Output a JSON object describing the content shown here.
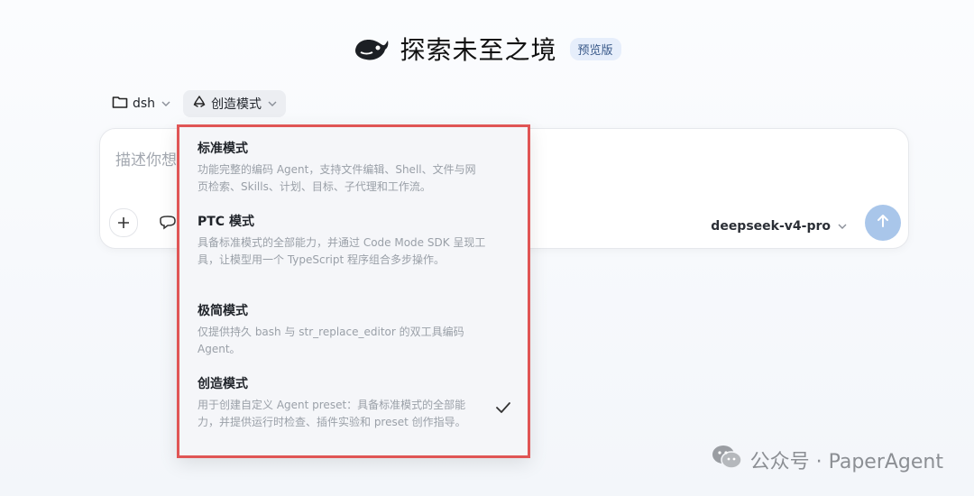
{
  "header": {
    "title": "探索未至之境",
    "badge": "预览版",
    "logo_icon": "whale-logo-icon"
  },
  "controls": {
    "folder": {
      "label": "dsh",
      "icon": "folder-icon"
    },
    "mode": {
      "label": "创造模式",
      "icon": "recycle-icon"
    }
  },
  "composer": {
    "placeholder": "描述你想",
    "model_label": "deepseek-v4-pro",
    "send_icon": "arrow-up-icon",
    "accent": "#a9c6ea"
  },
  "dropdown": {
    "border_color": "#e05555",
    "items": [
      {
        "name": "标准模式",
        "desc": "功能完整的编码 Agent，支持文件编辑、Shell、文件与网页检索、Skills、计划、目标、子代理和工作流。"
      },
      {
        "name": "PTC 模式",
        "desc": "具备标准模式的全部能力，并通过 Code Mode SDK 呈现工具，让模型用一个 TypeScript 程序组合多步操作。"
      },
      {
        "name": "极简模式",
        "desc": "仅提供持久 bash 与 str_replace_editor 的双工具编码 Agent。"
      },
      {
        "name": "创造模式",
        "desc": "用于创建自定义 Agent preset：具备标准模式的全部能力，并提供运行时检查、插件实验和 preset 创作指导。",
        "selected": true
      }
    ]
  },
  "watermark": {
    "text": "公众号 · PaperAgent"
  }
}
